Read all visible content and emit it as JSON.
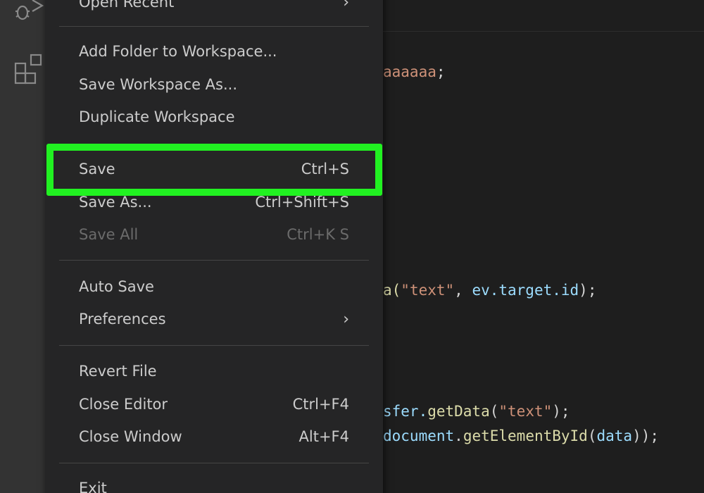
{
  "menu": {
    "items": [
      {
        "label": "Open Recent",
        "shortcut": "",
        "submenu": true,
        "disabled": false
      },
      {
        "label": "Add Folder to Workspace...",
        "shortcut": "",
        "submenu": false,
        "disabled": false
      },
      {
        "label": "Save Workspace As...",
        "shortcut": "",
        "submenu": false,
        "disabled": false
      },
      {
        "label": "Duplicate Workspace",
        "shortcut": "",
        "submenu": false,
        "disabled": false
      },
      {
        "label": "Save",
        "shortcut": "Ctrl+S",
        "submenu": false,
        "disabled": false,
        "highlighted": true
      },
      {
        "label": "Save As...",
        "shortcut": "Ctrl+Shift+S",
        "submenu": false,
        "disabled": false
      },
      {
        "label": "Save All",
        "shortcut": "Ctrl+K S",
        "submenu": false,
        "disabled": true
      },
      {
        "label": "Auto Save",
        "shortcut": "",
        "submenu": false,
        "disabled": false
      },
      {
        "label": "Preferences",
        "shortcut": "",
        "submenu": true,
        "disabled": false
      },
      {
        "label": "Revert File",
        "shortcut": "",
        "submenu": false,
        "disabled": false
      },
      {
        "label": "Close Editor",
        "shortcut": "Ctrl+F4",
        "submenu": false,
        "disabled": false
      },
      {
        "label": "Close Window",
        "shortcut": "Alt+F4",
        "submenu": false,
        "disabled": false
      },
      {
        "label": "Exit",
        "shortcut": "",
        "submenu": false,
        "disabled": false
      }
    ],
    "highlight_color": "#21f121"
  },
  "code": {
    "line1": {
      "a": "aaaaaa",
      "b": ";"
    },
    "line2": {
      "a": "a(",
      "b": "\"text\"",
      "c": ", ",
      "d": "ev.target.id",
      "e": ");"
    },
    "line3": {
      "a": "sfer.",
      "b": "getData",
      "c": "(",
      "d": "\"text\"",
      "e": ");"
    },
    "line4": {
      "a": "document",
      "b": ".",
      "c": "getElementById",
      "d": "(",
      "e": "data",
      "f": "));"
    }
  },
  "activity_bar": {
    "icons": [
      "debug-icon",
      "extensions-icon"
    ]
  },
  "colors": {
    "menu_bg": "#252526",
    "editor_bg": "#1e1e1e",
    "activity_bg": "#333333"
  }
}
